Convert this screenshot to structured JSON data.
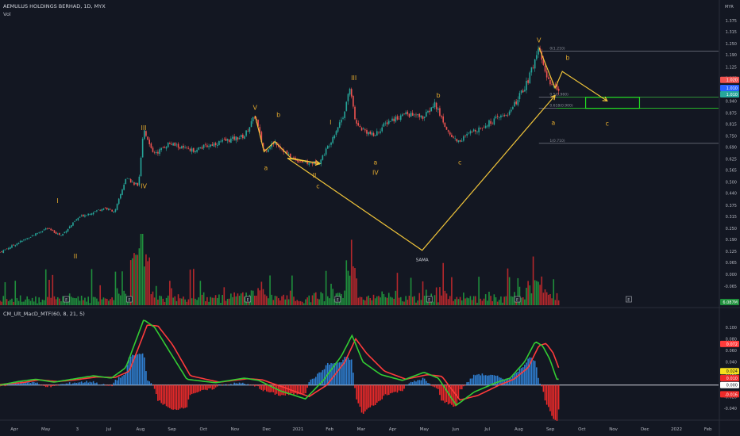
{
  "header": {
    "symbol_line": "AEMULUS HOLDINGS BERHAD, 1D, MYX",
    "vol_label": "Vol",
    "currency": "MYR"
  },
  "indicator": {
    "label": "CM_Ult_MacD_MTF(60, 8, 21, 5)"
  },
  "colors": {
    "background": "#131722",
    "up": "#26a69a",
    "down": "#ef5350",
    "vol_up": "#1f8f3c",
    "vol_down": "#b5282c",
    "wave": "#f0c43a",
    "label": "#e0a82e",
    "macd_fast": "#33cc33",
    "macd_slow": "#ff3b3b",
    "hist_up": "#2f7fd1",
    "hist_down": "#ee2a2a",
    "fib": "#8a8e99",
    "target_box": "#22dd22"
  },
  "chart_data": [
    {
      "type": "candlestick",
      "title": "AEMULUS HOLDINGS BERHAD, 1D, MYX",
      "x_ticks": [
        "Apr",
        "May",
        "3",
        "Jul",
        "Aug",
        "Sep",
        "Oct",
        "Nov",
        "Dec",
        "2021",
        "Feb",
        "Mar",
        "Apr",
        "May",
        "Jun",
        "Jul",
        "Aug",
        "Sep",
        "Oct",
        "Nov",
        "Dec",
        "2022",
        "Feb"
      ],
      "y_ticks": [
        "1.375",
        "1.315",
        "1.250",
        "1.190",
        "1.125",
        "1.065",
        "0.940",
        "0.875",
        "0.815",
        "0.750",
        "0.690",
        "0.625",
        "0.565",
        "0.500",
        "0.440",
        "0.375",
        "0.315",
        "0.250",
        "0.190",
        "0.125",
        "0.065",
        "0.000",
        "-0.065"
      ],
      "ylim": [
        -0.06,
        1.41
      ],
      "price_tags": [
        {
          "text": "1.020",
          "kind": "ask"
        },
        {
          "text": "1.010",
          "kind": "bid"
        },
        {
          "text": "1.010",
          "kind": "last"
        }
      ],
      "volume_tag": "6.087M",
      "key_prices": [
        {
          "t": 0,
          "v": 0.12
        },
        {
          "t": 0.1,
          "v": 0.22
        },
        {
          "t": 0.13,
          "v": 0.25
        },
        {
          "t": 0.17,
          "v": 0.21
        },
        {
          "t": 0.22,
          "v": 0.31
        },
        {
          "t": 0.29,
          "v": 0.36
        },
        {
          "t": 0.32,
          "v": 0.34
        },
        {
          "t": 0.35,
          "v": 0.52
        },
        {
          "t": 0.385,
          "v": 0.48
        },
        {
          "t": 0.4,
          "v": 0.79
        },
        {
          "t": 0.43,
          "v": 0.65
        },
        {
          "t": 0.47,
          "v": 0.71
        },
        {
          "t": 0.53,
          "v": 0.67
        },
        {
          "t": 0.6,
          "v": 0.71
        },
        {
          "t": 0.68,
          "v": 0.75
        },
        {
          "t": 0.71,
          "v": 0.86
        },
        {
          "t": 0.735,
          "v": 0.665
        },
        {
          "t": 0.765,
          "v": 0.72
        },
        {
          "t": 0.81,
          "v": 0.63
        },
        {
          "t": 0.86,
          "v": 0.6
        },
        {
          "t": 0.89,
          "v": 0.61
        },
        {
          "t": 0.92,
          "v": 0.72
        },
        {
          "t": 0.955,
          "v": 0.86
        },
        {
          "t": 0.975,
          "v": 1.02
        },
        {
          "t": 0.99,
          "v": 0.81
        },
        {
          "t": 1.04,
          "v": 0.75
        },
        {
          "t": 1.08,
          "v": 0.83
        },
        {
          "t": 1.13,
          "v": 0.87
        },
        {
          "t": 1.18,
          "v": 0.85
        },
        {
          "t": 1.21,
          "v": 0.925
        },
        {
          "t": 1.25,
          "v": 0.76
        },
        {
          "t": 1.275,
          "v": 0.72
        },
        {
          "t": 1.32,
          "v": 0.78
        },
        {
          "t": 1.38,
          "v": 0.84
        },
        {
          "t": 1.42,
          "v": 0.88
        },
        {
          "t": 1.45,
          "v": 0.98
        },
        {
          "t": 1.47,
          "v": 1.05
        },
        {
          "t": 1.5,
          "v": 1.23
        },
        {
          "t": 1.52,
          "v": 1.06
        },
        {
          "t": 1.55,
          "v": 1.01
        }
      ],
      "wave_labels": [
        {
          "text": "I",
          "t": 0.16,
          "v": 0.375,
          "anchor": "above"
        },
        {
          "text": "II",
          "t": 0.21,
          "v": 0.12,
          "anchor": "below"
        },
        {
          "text": "III",
          "t": 0.4,
          "v": 0.77,
          "anchor": "above"
        },
        {
          "text": "IV",
          "t": 0.4,
          "v": 0.5,
          "anchor": "below"
        },
        {
          "text": "V",
          "t": 0.71,
          "v": 0.88,
          "anchor": "above"
        },
        {
          "text": "a",
          "t": 0.74,
          "v": 0.6,
          "anchor": "below"
        },
        {
          "text": "b",
          "t": 0.775,
          "v": 0.84,
          "anchor": "above"
        },
        {
          "text": "c",
          "t": 0.885,
          "v": 0.5,
          "anchor": "below"
        },
        {
          "text": "II",
          "t": 0.875,
          "v": 0.56,
          "anchor": "below"
        },
        {
          "text": "I",
          "t": 0.92,
          "v": 0.8,
          "anchor": "above"
        },
        {
          "text": "III",
          "t": 0.985,
          "v": 1.04,
          "anchor": "above"
        },
        {
          "text": "a",
          "t": 1.045,
          "v": 0.63,
          "anchor": "below"
        },
        {
          "text": "IV",
          "t": 1.045,
          "v": 0.575,
          "anchor": "below"
        },
        {
          "text": "b",
          "t": 1.22,
          "v": 0.945,
          "anchor": "above"
        },
        {
          "text": "c",
          "t": 1.28,
          "v": 0.63,
          "anchor": "below"
        },
        {
          "text": "V",
          "t": 1.5,
          "v": 1.245,
          "anchor": "above"
        },
        {
          "text": "a",
          "t": 1.54,
          "v": 0.845,
          "anchor": "below"
        },
        {
          "text": "b",
          "t": 1.58,
          "v": 1.15,
          "anchor": "above"
        },
        {
          "text": "c",
          "t": 1.69,
          "v": 0.84,
          "anchor": "below"
        },
        {
          "text": "SAMA",
          "t": 1.175,
          "v": 0.105,
          "anchor": "below"
        }
      ],
      "wave_paths": [
        [
          [
            0.71,
            0.86
          ],
          [
            0.735,
            0.665
          ],
          [
            0.765,
            0.72
          ],
          [
            0.81,
            0.63
          ],
          [
            0.89,
            0.6
          ]
        ],
        [
          [
            0.8,
            0.63
          ],
          [
            0.89,
            0.6
          ]
        ],
        [
          [
            0.8,
            0.63
          ],
          [
            1.175,
            0.13
          ],
          [
            1.545,
            0.97
          ]
        ],
        [
          [
            1.5,
            1.23
          ],
          [
            1.545,
            1.01
          ],
          [
            1.565,
            1.1
          ],
          [
            1.69,
            0.94
          ]
        ]
      ],
      "fib_levels": [
        {
          "label": "0(1.210)",
          "v": 1.21
        },
        {
          "label": "0.5(0.960)",
          "v": 0.96
        },
        {
          "label": "0.618(0.900)",
          "v": 0.9
        },
        {
          "label": "1(0.710)",
          "v": 0.71
        }
      ],
      "target_zone": {
        "t0": 1.63,
        "t1": 1.78,
        "v0": 0.9,
        "v1": 0.96
      },
      "event_markers": [
        "E",
        "E",
        "E",
        "E",
        "E",
        "E",
        "E"
      ]
    },
    {
      "type": "line",
      "title": "CM_Ult_MacD_MTF(60, 8, 21, 5)",
      "y_ticks": [
        "0.100",
        "0.080",
        "0.060",
        "0.040",
        "0.020",
        "0.000",
        "-0.020",
        "-0.040"
      ],
      "ylim": [
        -0.047,
        0.112
      ],
      "value_tags": [
        {
          "text": "0.072",
          "kind": "slow"
        },
        {
          "text": "0.024",
          "kind": "signal"
        },
        {
          "text": "0.010",
          "kind": "fast"
        },
        {
          "text": "0.000",
          "kind": "zero"
        },
        {
          "text": "-0.016",
          "kind": "hist"
        }
      ],
      "series": [
        {
          "key_points": [
            {
              "t": 0,
              "v": 0.0
            },
            {
              "t": 0.05,
              "v": 0.006
            },
            {
              "t": 0.1,
              "v": 0.01
            },
            {
              "t": 0.15,
              "v": 0.005
            },
            {
              "t": 0.2,
              "v": 0.01
            },
            {
              "t": 0.26,
              "v": 0.016
            },
            {
              "t": 0.31,
              "v": 0.012
            },
            {
              "t": 0.35,
              "v": 0.03
            },
            {
              "t": 0.4,
              "v": 0.113
            },
            {
              "t": 0.43,
              "v": 0.1
            },
            {
              "t": 0.47,
              "v": 0.06
            },
            {
              "t": 0.52,
              "v": 0.01
            },
            {
              "t": 0.6,
              "v": 0.004
            },
            {
              "t": 0.68,
              "v": 0.012
            },
            {
              "t": 0.72,
              "v": 0.008
            },
            {
              "t": 0.78,
              "v": -0.01
            },
            {
              "t": 0.85,
              "v": -0.024
            },
            {
              "t": 0.9,
              "v": 0.008
            },
            {
              "t": 0.95,
              "v": 0.05
            },
            {
              "t": 0.98,
              "v": 0.086
            },
            {
              "t": 1.01,
              "v": 0.04
            },
            {
              "t": 1.06,
              "v": 0.018
            },
            {
              "t": 1.12,
              "v": 0.008
            },
            {
              "t": 1.18,
              "v": 0.022
            },
            {
              "t": 1.22,
              "v": 0.012
            },
            {
              "t": 1.27,
              "v": -0.035
            },
            {
              "t": 1.32,
              "v": -0.012
            },
            {
              "t": 1.38,
              "v": 0.004
            },
            {
              "t": 1.42,
              "v": 0.012
            },
            {
              "t": 1.46,
              "v": 0.04
            },
            {
              "t": 1.49,
              "v": 0.075
            },
            {
              "t": 1.51,
              "v": 0.068
            },
            {
              "t": 1.53,
              "v": 0.045
            },
            {
              "t": 1.55,
              "v": 0.01
            }
          ]
        },
        {
          "key_points": [
            {
              "t": 0,
              "v": 0.001
            },
            {
              "t": 0.06,
              "v": 0.004
            },
            {
              "t": 0.11,
              "v": 0.009
            },
            {
              "t": 0.16,
              "v": 0.006
            },
            {
              "t": 0.21,
              "v": 0.009
            },
            {
              "t": 0.27,
              "v": 0.014
            },
            {
              "t": 0.32,
              "v": 0.013
            },
            {
              "t": 0.36,
              "v": 0.024
            },
            {
              "t": 0.41,
              "v": 0.104
            },
            {
              "t": 0.44,
              "v": 0.102
            },
            {
              "t": 0.48,
              "v": 0.07
            },
            {
              "t": 0.53,
              "v": 0.016
            },
            {
              "t": 0.61,
              "v": 0.005
            },
            {
              "t": 0.69,
              "v": 0.011
            },
            {
              "t": 0.73,
              "v": 0.009
            },
            {
              "t": 0.79,
              "v": -0.004
            },
            {
              "t": 0.86,
              "v": -0.02
            },
            {
              "t": 0.91,
              "v": 0.0
            },
            {
              "t": 0.96,
              "v": 0.04
            },
            {
              "t": 0.99,
              "v": 0.08
            },
            {
              "t": 1.02,
              "v": 0.055
            },
            {
              "t": 1.07,
              "v": 0.024
            },
            {
              "t": 1.13,
              "v": 0.01
            },
            {
              "t": 1.19,
              "v": 0.018
            },
            {
              "t": 1.23,
              "v": 0.015
            },
            {
              "t": 1.28,
              "v": -0.026
            },
            {
              "t": 1.33,
              "v": -0.018
            },
            {
              "t": 1.39,
              "v": 0.0
            },
            {
              "t": 1.43,
              "v": 0.01
            },
            {
              "t": 1.47,
              "v": 0.03
            },
            {
              "t": 1.5,
              "v": 0.068
            },
            {
              "t": 1.52,
              "v": 0.072
            },
            {
              "t": 1.54,
              "v": 0.055
            },
            {
              "t": 1.555,
              "v": 0.03
            }
          ]
        }
      ]
    }
  ]
}
